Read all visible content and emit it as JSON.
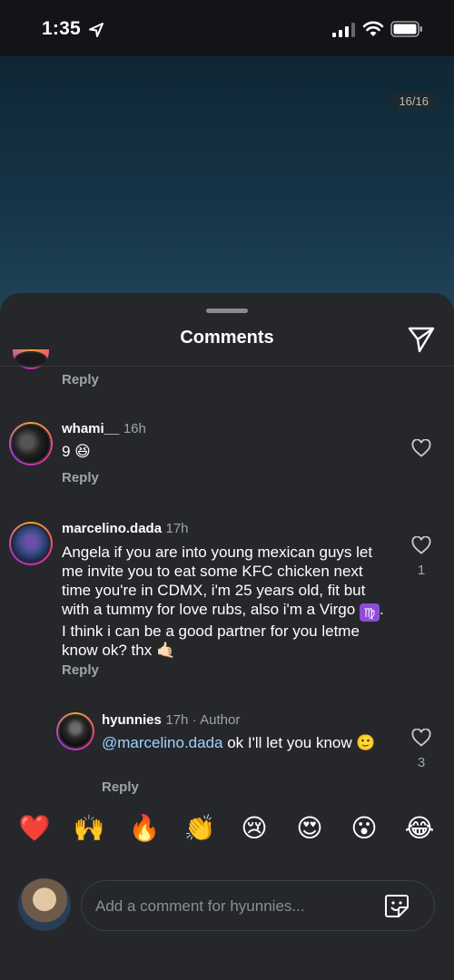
{
  "status_bar": {
    "time": "1:35"
  },
  "story": {
    "counter": "16/16"
  },
  "sheet": {
    "title": "Comments"
  },
  "partial_comment": {
    "reply": "Reply"
  },
  "comments": [
    {
      "username": "whami__",
      "time": "16h",
      "text": "9 😆",
      "reply": "Reply"
    },
    {
      "username": "marcelino.dada",
      "time": "17h",
      "text_before_badge": "Angela if you are into young mexican guys let me invite you to eat some KFC chicken next time you're in CDMX, i'm 25 years old, fit but with a tummy for love rubs, also i'm a Virgo ",
      "badge": "♍",
      "text_after_badge": ". I think i can be a good partner for you letme know ok? thx 🤙🏻",
      "likes": "1",
      "reply": "Reply"
    },
    {
      "username": "hyunnies",
      "time": "17h",
      "author_label": "· Author",
      "mention": "@marcelino.dada",
      "text": " ok I'll let you know 🙂",
      "likes": "3",
      "reply": "Reply"
    }
  ],
  "quick_reactions": [
    "❤️",
    "🙌",
    "🔥",
    "👏",
    "😢",
    "😍",
    "😮",
    "😂"
  ],
  "composer": {
    "placeholder": "Add a comment for hyunnies..."
  },
  "colors": {
    "sheet_bg": "#25272b",
    "mention": "#9fd2ff",
    "muted": "#a0a3a8"
  }
}
